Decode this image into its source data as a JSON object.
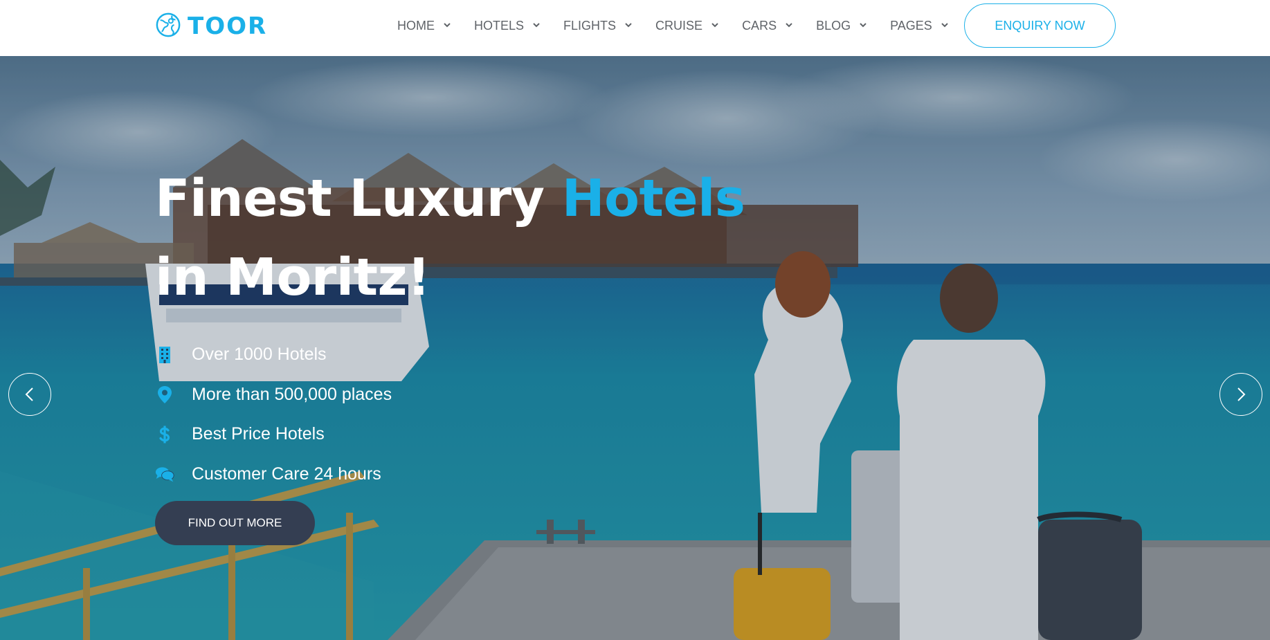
{
  "brand": {
    "name": "TOOR",
    "color": "#1ab0e8",
    "icon": "globe-icon"
  },
  "nav": {
    "items": [
      {
        "label": "HOME",
        "icon": "chevron-down-icon"
      },
      {
        "label": "HOTELS",
        "icon": "chevron-down-icon"
      },
      {
        "label": "FLIGHTS",
        "icon": "chevron-down-icon"
      },
      {
        "label": "CRUISE",
        "icon": "chevron-down-icon"
      },
      {
        "label": "CARS",
        "icon": "chevron-down-icon"
      },
      {
        "label": "BLOG",
        "icon": "chevron-down-icon"
      },
      {
        "label": "PAGES",
        "icon": "chevron-down-icon"
      }
    ],
    "cta_label": "ENQUIRY NOW"
  },
  "hero": {
    "title_line1_prefix": "Finest Luxury ",
    "title_line1_accent": "Hotels",
    "title_line2": "in Moritz!",
    "features": [
      {
        "icon": "building-icon",
        "text": "Over 1000 Hotels"
      },
      {
        "icon": "map-pin-icon",
        "text": "More than 500,000 places"
      },
      {
        "icon": "dollar-icon",
        "text": "Best Price Hotels"
      },
      {
        "icon": "chat-bubbles-icon",
        "text": "Customer Care 24 hours"
      }
    ],
    "button_label": "FIND OUT MORE",
    "prev_icon": "chevron-left-icon",
    "next_icon": "chevron-right-icon"
  },
  "colors": {
    "accent": "#1ab0e8",
    "button_dark": "#343e52",
    "nav_text": "#5f6368"
  }
}
